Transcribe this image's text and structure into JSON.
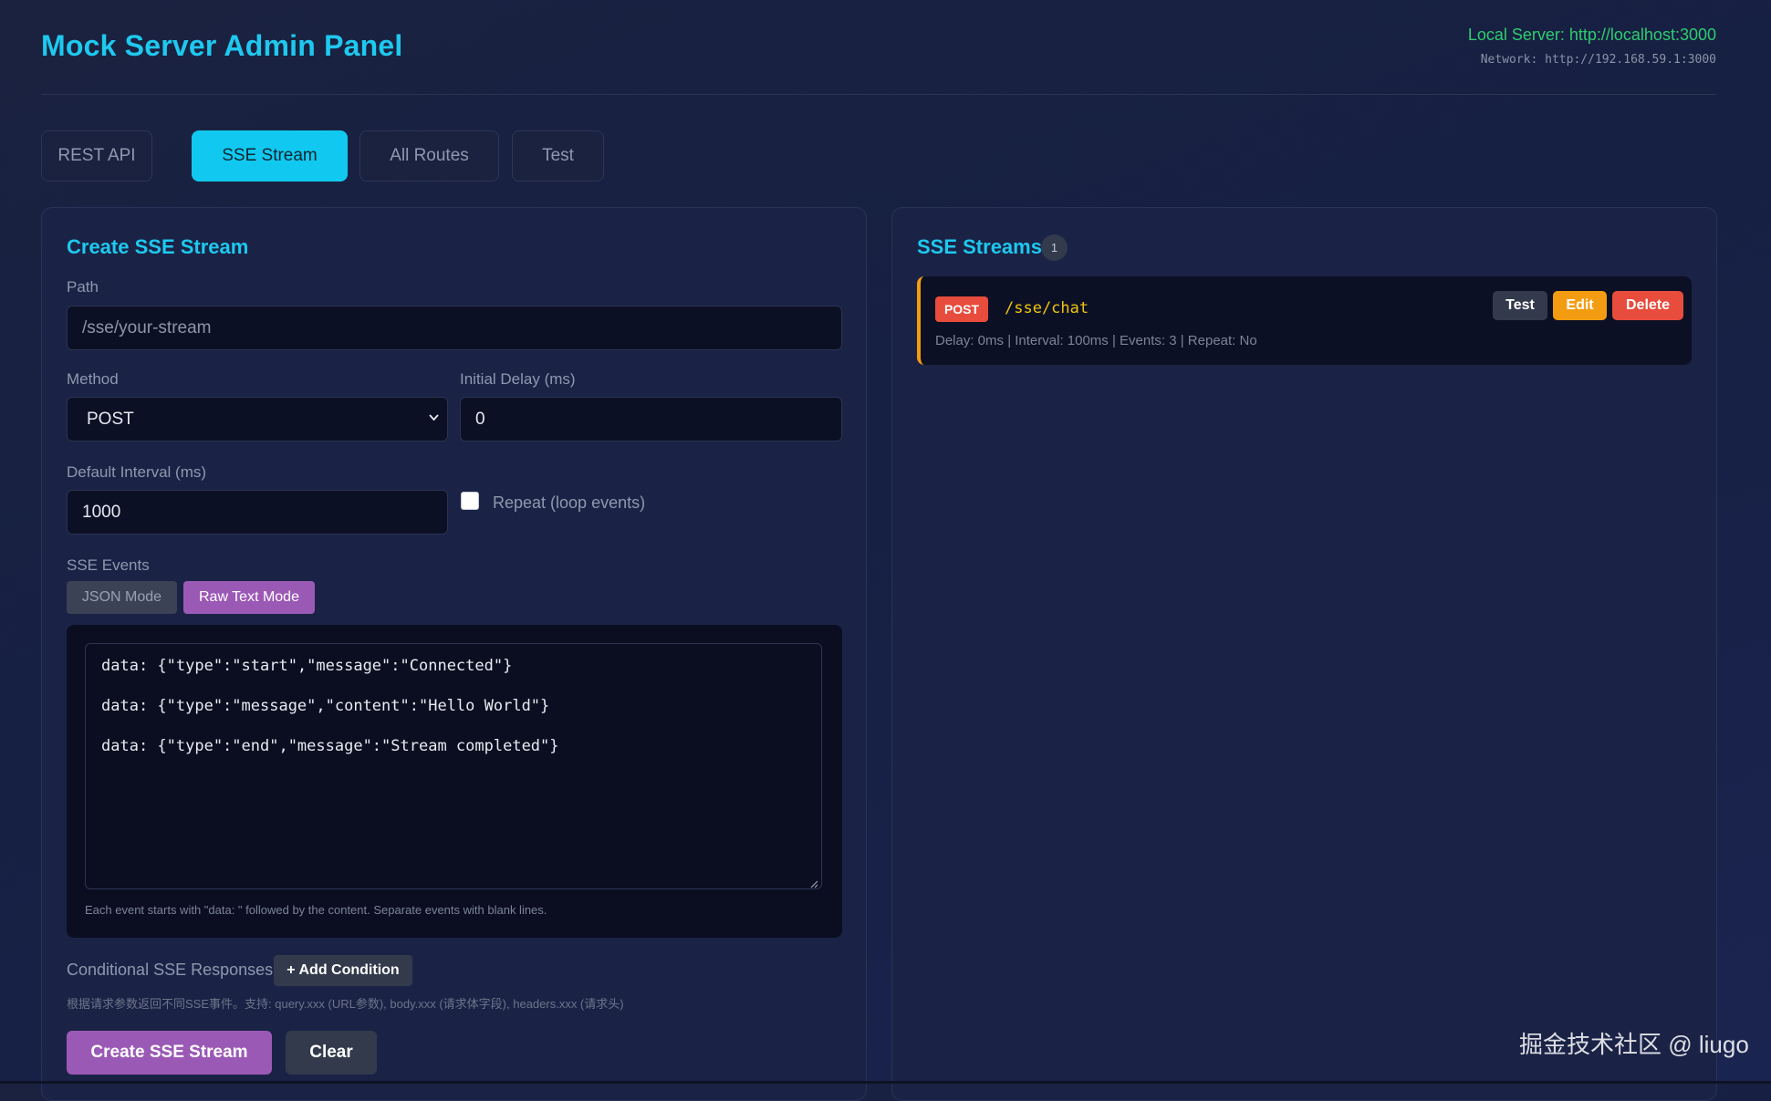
{
  "header": {
    "title": "Mock Server Admin Panel",
    "local_server": "Local Server: http://localhost:3000",
    "network": "Network: http://192.168.59.1:3000"
  },
  "tabs": [
    {
      "label": "REST API",
      "active": false
    },
    {
      "label": "SSE Stream",
      "active": true
    },
    {
      "label": "All Routes",
      "active": false
    },
    {
      "label": "Test",
      "active": false
    }
  ],
  "create_form": {
    "title": "Create SSE Stream",
    "path_label": "Path",
    "path_placeholder": "/sse/your-stream",
    "method_label": "Method",
    "method_value": "POST",
    "initial_delay_label": "Initial Delay (ms)",
    "initial_delay_value": "0",
    "default_interval_label": "Default Interval (ms)",
    "default_interval_value": "1000",
    "repeat_label": "Repeat (loop events)",
    "repeat_checked": false,
    "sse_events_label": "SSE Events",
    "json_mode_label": "JSON Mode",
    "raw_text_mode_label": "Raw Text Mode",
    "active_mode": "Raw Text Mode",
    "events_text": [
      "data: {\"type\":\"start\",\"message\":\"Connected\"}",
      "data: {\"type\":\"message\",\"content\":\"Hello World\"}",
      "data: {\"type\":\"end\",\"message\":\"Stream completed\"}"
    ],
    "events_hint": "Each event starts with \"data: \" followed by the content. Separate events with blank lines.",
    "conditional_label": "Conditional SSE Responses",
    "add_condition_label": "+ Add Condition",
    "conditional_note": "根据请求参数返回不同SSE事件。支持: query.xxx (URL参数), body.xxx (请求体字段), headers.xxx (请求头)",
    "create_button": "Create SSE Stream",
    "clear_button": "Clear"
  },
  "streams": {
    "title": "SSE Streams",
    "count": "1",
    "items": [
      {
        "method": "POST",
        "path": "/sse/chat",
        "meta": "Delay: 0ms | Interval: 100ms | Events: 3 | Repeat: No",
        "test_label": "Test",
        "edit_label": "Edit",
        "delete_label": "Delete"
      }
    ]
  },
  "watermark": "掘金技术社区 @ liugo",
  "colors": {
    "accent_cyan": "#1fc8ee",
    "server_green": "#2ecc71",
    "purple": "#9b59b6",
    "delete_red": "#e74c3c",
    "edit_orange": "#f39c12",
    "path_yellow": "#f1c40f"
  }
}
